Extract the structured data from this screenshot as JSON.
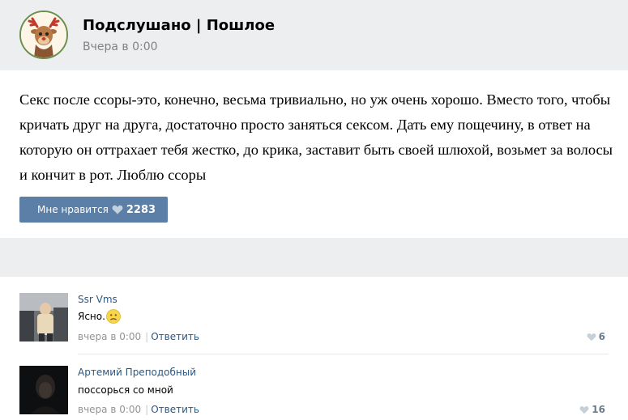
{
  "post": {
    "group_name": "Подслушано | Пошлое",
    "date": "Вчера в 0:00",
    "text": "Секс после ссоры-это, конечно, весьма тривиально, но уж очень хорошо. Вместо того, чтобы кричать друг на друга, достаточно просто заняться сексом. Дать ему пощечину, в ответ на которую он оттрахает тебя жестко, до крика, заставит быть своей шлюхой, возьмет за волосы и кончит в рот. Люблю ссоры",
    "like_label": "Мне нравится",
    "like_count": "2283"
  },
  "comments": [
    {
      "author": "Ssr Vms",
      "text": "Ясно.",
      "emoji": "slightly-frowning-face-icon",
      "date": "вчера в 0:00",
      "reply_label": "Ответить",
      "likes": "6"
    },
    {
      "author": "Артемий Преподобный",
      "text": "поссорься со мной",
      "date": "вчера в 0:00",
      "reply_label": "Ответить",
      "likes": "16"
    }
  ],
  "colors": {
    "header_bg": "#edeef0",
    "like_button_bg": "#5b7fa6",
    "link": "#2a5885",
    "meta": "#939393"
  }
}
